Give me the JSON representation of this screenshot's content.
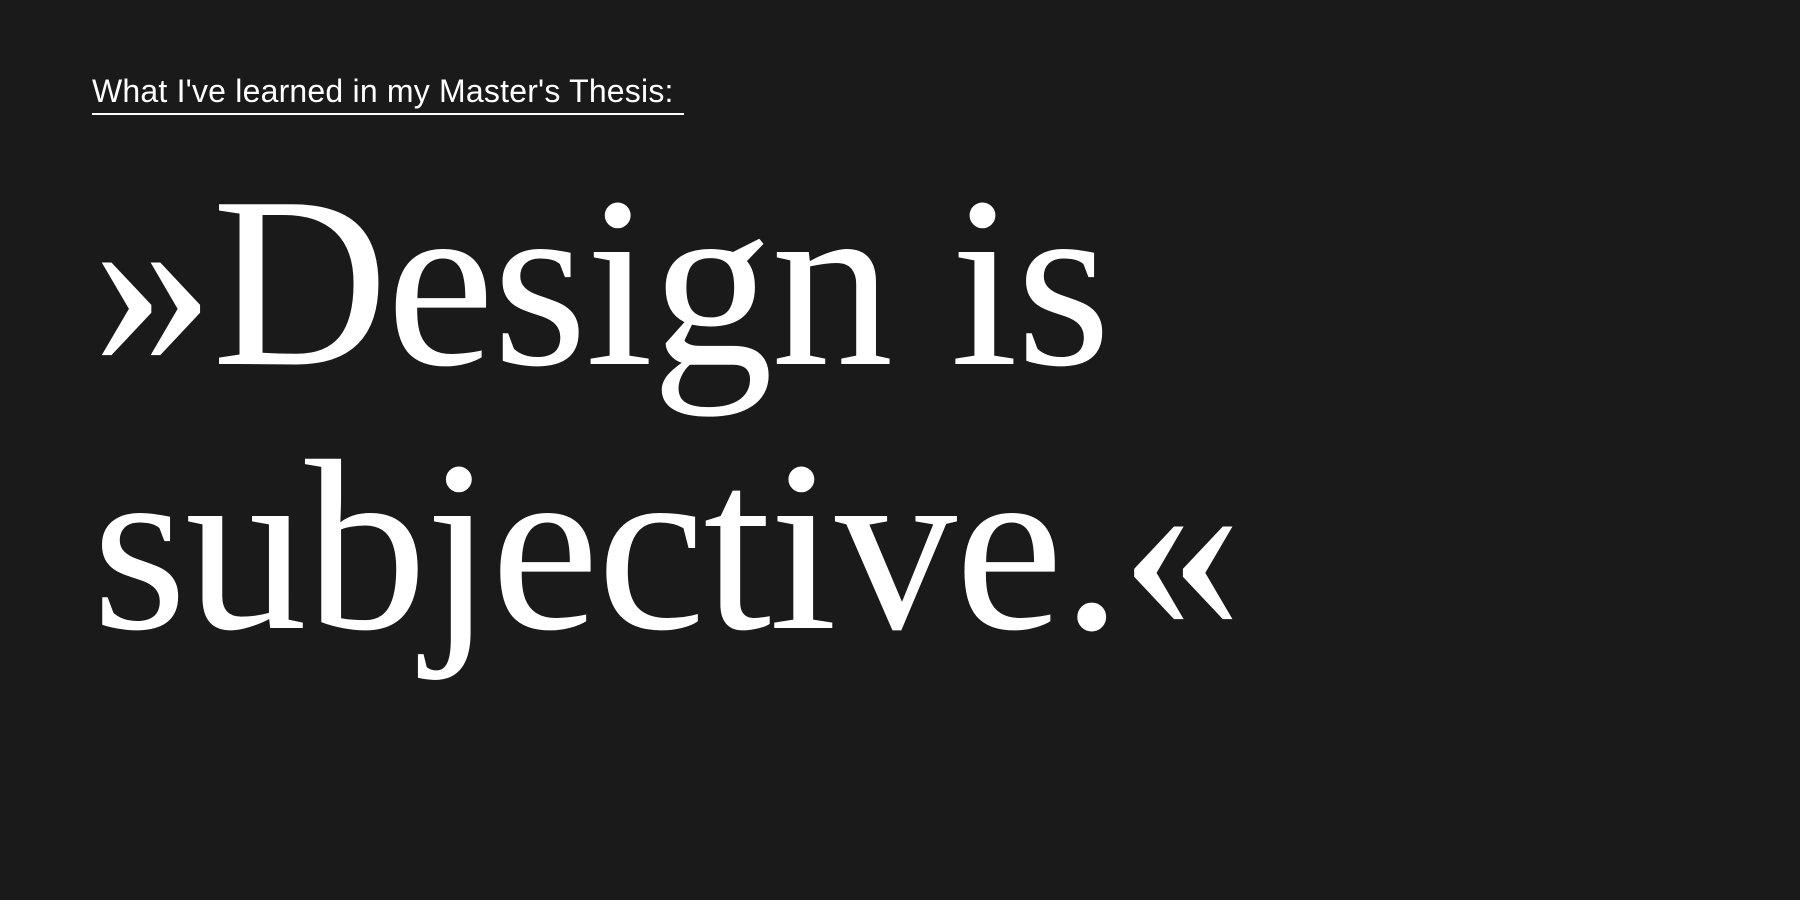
{
  "kicker": "What I've learned in my Master's Thesis:",
  "quote": {
    "line1": "»Design is",
    "line2": "subjective.«"
  },
  "colors": {
    "background": "#1a1a1a",
    "text": "#ffffff"
  }
}
